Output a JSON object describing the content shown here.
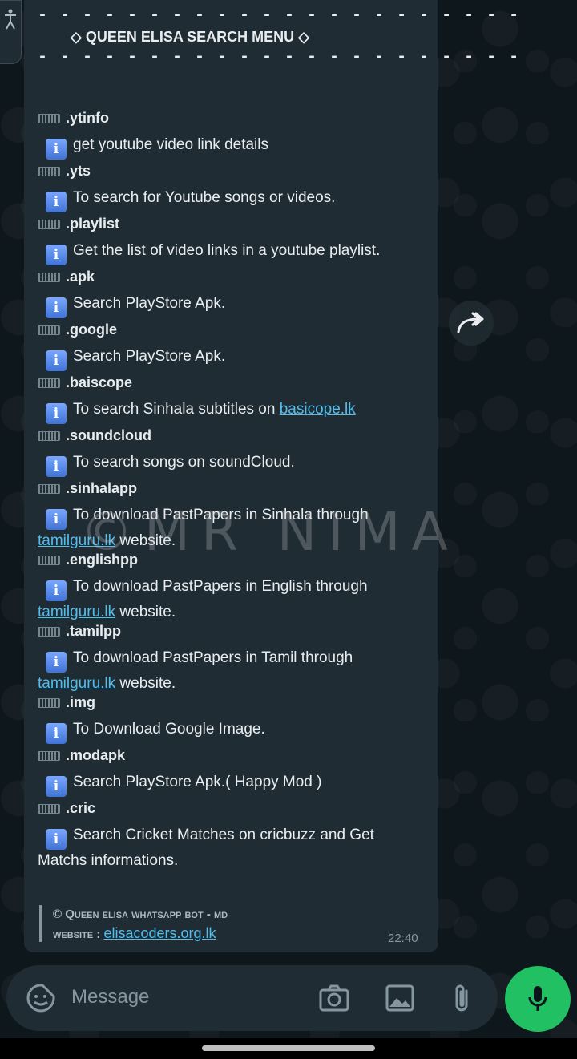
{
  "chat": {
    "divider": "- - - - - - - - - - - - - - - - - - - - - -",
    "title": "◇ QUEEN ELISA SEARCH MENU ◇",
    "info_glyph": "i",
    "commands": [
      {
        "name": ".ytinfo",
        "desc": "get youtube video link details"
      },
      {
        "name": ".yts",
        "desc": "To search for Youtube songs or videos."
      },
      {
        "name": ".playlist",
        "desc": "Get the list of video links in a youtube playlist."
      },
      {
        "name": ".apk",
        "desc": "Search PlayStore Apk."
      },
      {
        "name": ".google",
        "desc": "Search PlayStore Apk."
      },
      {
        "name": ".baiscope",
        "desc_before": "To search Sinhala subtitles on ",
        "link": "basicope.lk"
      },
      {
        "name": ".soundcloud",
        "desc": "To search songs on soundCloud."
      },
      {
        "name": ".sinhalapp",
        "desc_before": "To download PastPapers in Sinhala through ",
        "link": "tamilguru.lk",
        "desc_after": " website."
      },
      {
        "name": ".englishpp",
        "desc_before": "To download PastPapers in English through ",
        "link": "tamilguru.lk",
        "desc_after": " website."
      },
      {
        "name": ".tamilpp",
        "desc_before": "To download PastPapers in Tamil through ",
        "link": "tamilguru.lk",
        "desc_after": " website."
      },
      {
        "name": ".img",
        "desc": "To Download Google Image."
      },
      {
        "name": ".modapk",
        "desc": "Search PlayStore Apk.( Happy Mod )"
      },
      {
        "name": ".cric",
        "desc": "Search Cricket Matches on cricbuzz and Get Matchs informations."
      }
    ],
    "footer": {
      "line1": "© Queen elisa whatsapp bot - md",
      "website_label": "website : ",
      "website_link": "elisacoders.org.lk"
    },
    "time": "22:40",
    "watermark": "©MR NIMA"
  },
  "input": {
    "placeholder": "Message"
  },
  "icons": {
    "sticker": "sticker-icon",
    "camera": "camera-icon",
    "gallery": "gallery-icon",
    "attach": "paperclip-icon",
    "mic": "microphone-icon",
    "forward": "forward-icon",
    "accessibility": "accessibility-icon"
  },
  "colors": {
    "bubble": "#1f2c34",
    "link": "#53bdeb",
    "send_button": "#21c063",
    "background": "#0b141a"
  }
}
